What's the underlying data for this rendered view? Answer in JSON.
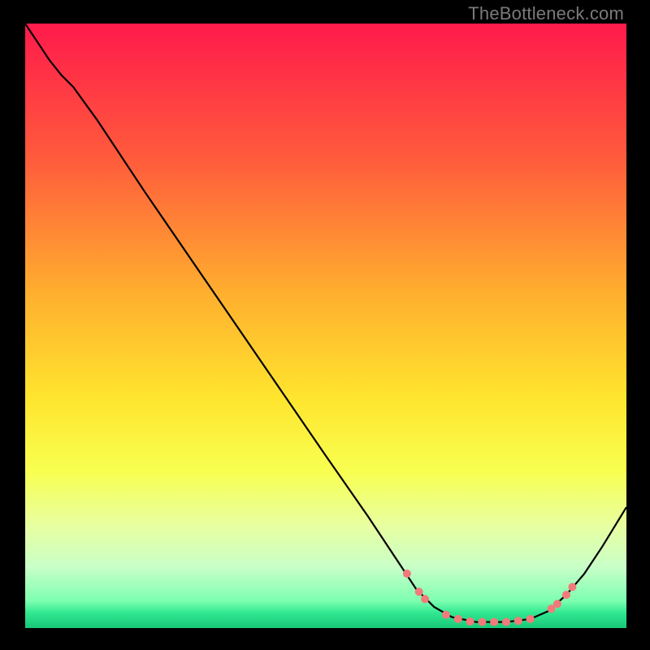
{
  "watermark": "TheBottleneck.com",
  "chart_data": {
    "type": "line",
    "title": "",
    "xlabel": "",
    "ylabel": "",
    "xlim": [
      0,
      100
    ],
    "ylim": [
      0,
      100
    ],
    "gradient_stops": [
      {
        "offset": 0.0,
        "color": "#ff1a4b"
      },
      {
        "offset": 0.22,
        "color": "#ff5a3c"
      },
      {
        "offset": 0.45,
        "color": "#ffb02e"
      },
      {
        "offset": 0.62,
        "color": "#ffe52e"
      },
      {
        "offset": 0.74,
        "color": "#f8ff50"
      },
      {
        "offset": 0.83,
        "color": "#e8ffa0"
      },
      {
        "offset": 0.9,
        "color": "#c8ffc8"
      },
      {
        "offset": 0.955,
        "color": "#7dffb0"
      },
      {
        "offset": 0.975,
        "color": "#30e890"
      },
      {
        "offset": 1.0,
        "color": "#18c878"
      }
    ],
    "curve": [
      {
        "x": 0.0,
        "y": 100.0
      },
      {
        "x": 4.0,
        "y": 94.0
      },
      {
        "x": 6.0,
        "y": 91.5
      },
      {
        "x": 8.0,
        "y": 89.5
      },
      {
        "x": 12.0,
        "y": 84.0
      },
      {
        "x": 20.0,
        "y": 72.0
      },
      {
        "x": 30.0,
        "y": 57.5
      },
      {
        "x": 40.0,
        "y": 43.0
      },
      {
        "x": 50.0,
        "y": 28.5
      },
      {
        "x": 57.0,
        "y": 18.5
      },
      {
        "x": 62.0,
        "y": 11.0
      },
      {
        "x": 65.0,
        "y": 6.5
      },
      {
        "x": 68.0,
        "y": 3.5
      },
      {
        "x": 71.0,
        "y": 1.8
      },
      {
        "x": 75.0,
        "y": 1.0
      },
      {
        "x": 80.0,
        "y": 1.0
      },
      {
        "x": 84.0,
        "y": 1.5
      },
      {
        "x": 87.0,
        "y": 2.8
      },
      {
        "x": 90.0,
        "y": 5.5
      },
      {
        "x": 93.0,
        "y": 9.0
      },
      {
        "x": 96.0,
        "y": 13.5
      },
      {
        "x": 100.0,
        "y": 20.0
      }
    ],
    "markers": [
      {
        "x": 63.5,
        "y": 9.0
      },
      {
        "x": 65.5,
        "y": 6.0
      },
      {
        "x": 66.5,
        "y": 4.8
      },
      {
        "x": 70.0,
        "y": 2.2
      },
      {
        "x": 72.0,
        "y": 1.5
      },
      {
        "x": 74.0,
        "y": 1.1
      },
      {
        "x": 76.0,
        "y": 1.0
      },
      {
        "x": 78.0,
        "y": 1.0
      },
      {
        "x": 80.0,
        "y": 1.0
      },
      {
        "x": 82.0,
        "y": 1.2
      },
      {
        "x": 84.0,
        "y": 1.5
      },
      {
        "x": 87.5,
        "y": 3.2
      },
      {
        "x": 88.5,
        "y": 4.0
      },
      {
        "x": 90.0,
        "y": 5.5
      },
      {
        "x": 91.0,
        "y": 6.8
      }
    ],
    "marker_color": "#f27a7a",
    "marker_radius": 5
  }
}
